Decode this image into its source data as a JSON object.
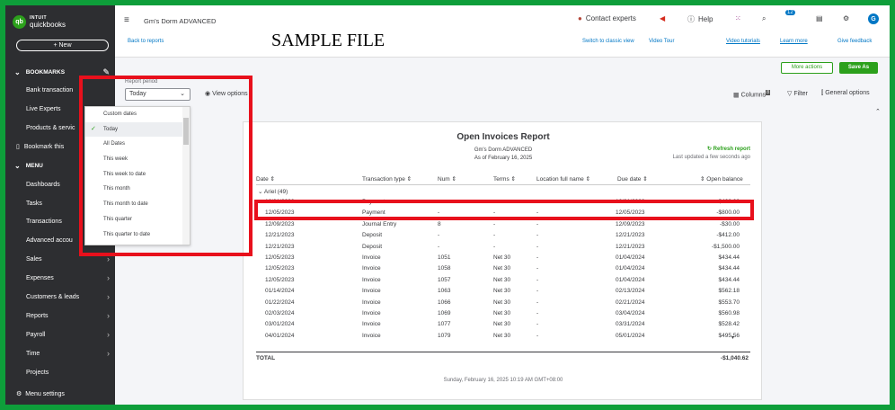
{
  "sample_label": "SAMPLE FILE",
  "logo": {
    "top": "INTUIT",
    "name": "quickbooks",
    "mark": "qb"
  },
  "new_button": "+ New",
  "sidebar": {
    "bookmarks_header": "BOOKMARKS",
    "bookmark_items": [
      "Bank transaction",
      "Live Experts",
      "Products & servic",
      "Bookmark this"
    ],
    "menu_header": "MENU",
    "menu_items": [
      "Dashboards",
      "Tasks",
      "Transactions",
      "Advanced accou",
      "Sales",
      "Expenses",
      "Customers & leads",
      "Reports",
      "Payroll",
      "Time",
      "Projects"
    ],
    "settings": "Menu settings"
  },
  "topbar": {
    "company": "Gm's Dorm ADVANCED",
    "contact": "Contact experts",
    "help": "Help",
    "notif_count": "12",
    "avatar": "G"
  },
  "subbar": {
    "back": "Back to reports",
    "switch": "Switch to classic view",
    "video_tour": "Video Tour",
    "video_tutorials": "Video tutorials",
    "learn_more": "Learn more",
    "give_feedback": "Give feedback"
  },
  "actions": {
    "more": "More actions",
    "save": "Save As"
  },
  "report_period": {
    "label": "Report period",
    "value": "Today",
    "options": [
      "Custom dates",
      "Today",
      "All Dates",
      "This week",
      "This week to date",
      "This month",
      "This month to date",
      "This quarter",
      "This quarter to date"
    ],
    "selected_index": 1
  },
  "view_options": "View options",
  "tools": {
    "columns": "Columns",
    "columns_count": "8",
    "filter": "Filter",
    "general": "General options"
  },
  "report": {
    "title": "Open Invoices Report",
    "company": "Gm's Dorm ADVANCED",
    "as_of": "As of February 16, 2025",
    "refresh": "Refresh report",
    "updated": "Last updated a few seconds ago",
    "columns": [
      "Date",
      "Transaction type",
      "Num",
      "Terms",
      "Location full name",
      "Due date",
      "Open balance"
    ],
    "group": "Ariel (49)",
    "rows": [
      [
        "12/01/2023",
        "Payment",
        "-",
        "-",
        "-",
        "12/01/2023",
        "-$400.00"
      ],
      [
        "12/05/2023",
        "Payment",
        "-",
        "-",
        "-",
        "12/05/2023",
        "-$800.00"
      ],
      [
        "12/09/2023",
        "Journal Entry",
        "8",
        "-",
        "-",
        "12/09/2023",
        "-$30.00"
      ],
      [
        "12/21/2023",
        "Deposit",
        "-",
        "-",
        "-",
        "12/21/2023",
        "-$412.00"
      ],
      [
        "12/21/2023",
        "Deposit",
        "-",
        "-",
        "-",
        "12/21/2023",
        "-$1,500.00"
      ],
      [
        "12/05/2023",
        "Invoice",
        "1051",
        "Net 30",
        "-",
        "01/04/2024",
        "$434.44"
      ],
      [
        "12/05/2023",
        "Invoice",
        "1058",
        "Net 30",
        "-",
        "01/04/2024",
        "$434.44"
      ],
      [
        "12/05/2023",
        "Invoice",
        "1057",
        "Net 30",
        "-",
        "01/04/2024",
        "$434.44"
      ],
      [
        "01/14/2024",
        "Invoice",
        "1063",
        "Net 30",
        "-",
        "02/13/2024",
        "$562.18"
      ],
      [
        "01/22/2024",
        "Invoice",
        "1066",
        "Net 30",
        "-",
        "02/21/2024",
        "$553.70"
      ],
      [
        "02/03/2024",
        "Invoice",
        "1069",
        "Net 30",
        "-",
        "03/04/2024",
        "$560.98"
      ],
      [
        "03/01/2024",
        "Invoice",
        "1077",
        "Net 30",
        "-",
        "03/31/2024",
        "$528.42"
      ],
      [
        "04/01/2024",
        "Invoice",
        "1079",
        "Net 30",
        "-",
        "05/01/2024",
        "$495.56"
      ]
    ],
    "total_label": "TOTAL",
    "total_value": "-$1,040.62",
    "footer": "Sunday, February 16, 2025 10:19 AM GMT+08:00"
  }
}
